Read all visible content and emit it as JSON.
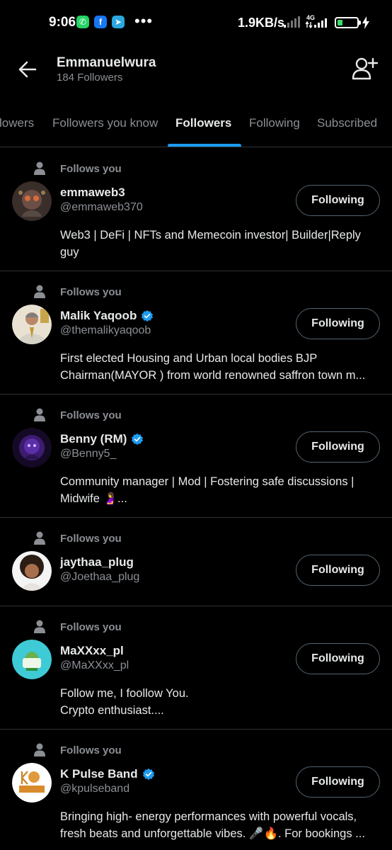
{
  "status_bar": {
    "time": "9:06",
    "speed": "1.9KB/s",
    "network": "4G",
    "battery": "27",
    "battery_level": 0.27,
    "apps": [
      "whatsapp-icon",
      "facebook-icon",
      "telegram-icon"
    ],
    "more": "•••"
  },
  "header": {
    "title": "Emmanuelwura",
    "subtitle": "184 Followers"
  },
  "tabs": [
    {
      "label": "lowers"
    },
    {
      "label": "Followers you know"
    },
    {
      "label": "Followers"
    },
    {
      "label": "Following"
    },
    {
      "label": "Subscribed"
    }
  ],
  "active_tab": "Followers",
  "colors": {
    "accent": "#1d9bf0",
    "background": "#000000",
    "secondary_text": "#8b8f94",
    "divider": "#2f3336"
  },
  "followers": [
    {
      "follows_you": "Follows you",
      "name": "emmaweb3",
      "handle": "@emmaweb370",
      "verified": false,
      "button": "Following",
      "bio": "Web3 | DeFi | NFTs and Memecoin investor| Builder|Reply guy"
    },
    {
      "follows_you": "Follows you",
      "name": "Malik Yaqoob",
      "handle": "@themalikyaqoob",
      "verified": true,
      "button": "Following",
      "bio": "First elected Housing and Urban local bodies BJP Chairman(MAYOR ) from world renowned saffron town m..."
    },
    {
      "follows_you": "Follows you",
      "name": "Benny (RM)",
      "handle": "@Benny5_",
      "verified": true,
      "button": "Following",
      "bio": "Community manager | Mod | Fostering safe discussions | Midwife 🤰..."
    },
    {
      "follows_you": "Follows you",
      "name": "jaythaa_plug",
      "handle": "@Joethaa_plug",
      "verified": false,
      "button": "Following",
      "bio": ""
    },
    {
      "follows_you": "Follows you",
      "name": "MaXXxx_pl",
      "handle": "@MaXXxx_pl",
      "verified": false,
      "button": "Following",
      "bio": "Follow me, I foollow You.\nCrypto enthusiast...."
    },
    {
      "follows_you": "Follows you",
      "name": "K Pulse Band",
      "handle": "@kpulseband",
      "verified": true,
      "button": "Following",
      "bio": "Bringing high- energy performances with powerful vocals, fresh beats and unforgettable vibes. 🎤🔥. For bookings ..."
    }
  ]
}
